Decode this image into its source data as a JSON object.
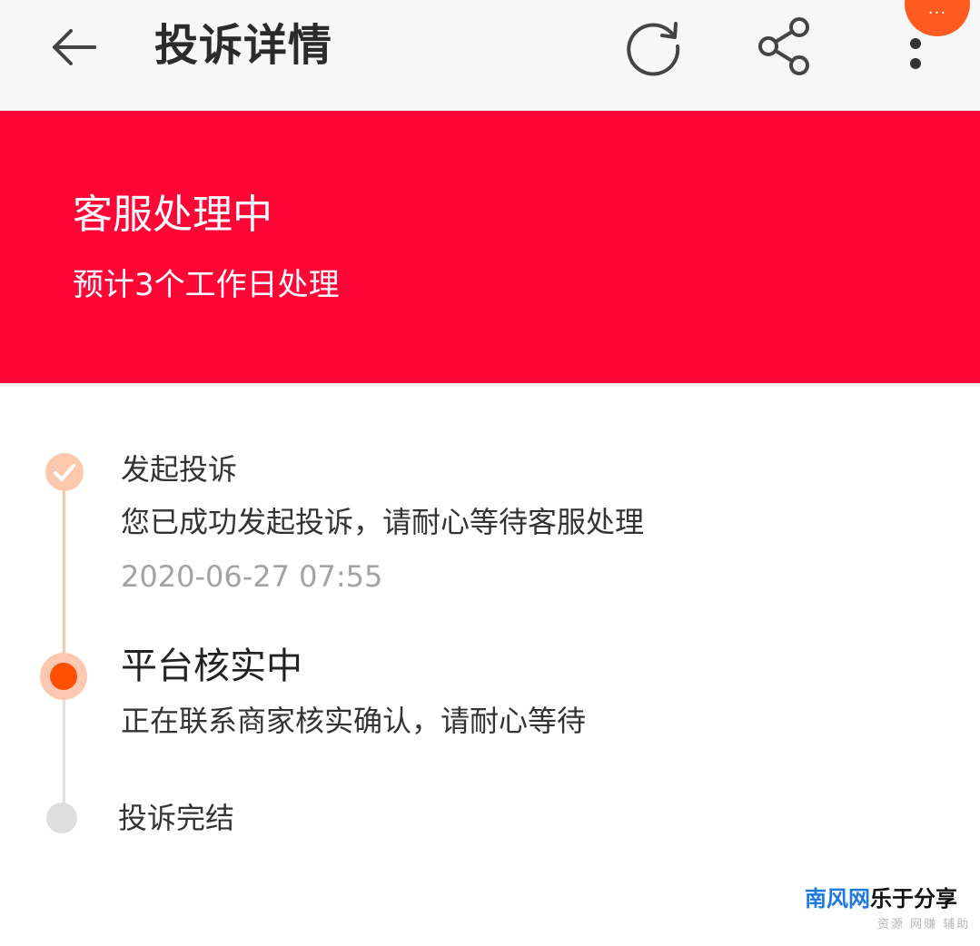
{
  "header": {
    "title": "投诉详情",
    "back_icon": "arrow-left-icon",
    "refresh_icon": "refresh-icon",
    "share_icon": "share-icon",
    "more_icon": "more-vertical-icon",
    "floating_badge": "···"
  },
  "status_banner": {
    "title": "客服处理中",
    "subtitle": "预计3个工作日处理",
    "color": "#ff0637"
  },
  "timeline": {
    "steps": [
      {
        "title": "发起投诉",
        "description": "您已成功发起投诉，请耐心等待客服处理",
        "time": "2020-06-27 07:55",
        "state": "done"
      },
      {
        "title": "平台核实中",
        "description": "正在联系商家核实确认，请耐心等待",
        "state": "current"
      },
      {
        "title": "投诉完结",
        "state": "pending"
      }
    ],
    "colors": {
      "done": "#fcc9ae",
      "current": "#ff4f00",
      "pending": "#dedede"
    }
  },
  "watermark": {
    "brand_blue": "南风网",
    "brand_black": "乐于分享",
    "tagline": "资源 网赚 辅助"
  }
}
